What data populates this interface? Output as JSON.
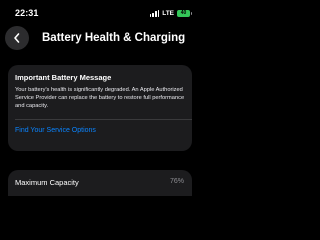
{
  "status_bar": {
    "time": "22:31",
    "network": "LTE",
    "battery_text": "40",
    "signal_icon": "cellular-signal-icon",
    "battery_icon": "battery-charging-icon",
    "battery_color": "#34c759"
  },
  "header": {
    "back_icon": "chevron-left-icon",
    "title": "Battery Health & Charging"
  },
  "message_card": {
    "title": "Important Battery Message",
    "body": "Your battery's health is significantly degraded. An Apple Authorized Service Provider can replace the battery to restore full performance and capacity.",
    "link_label": "Find Your Service Options",
    "link_color": "#0a84ff"
  },
  "capacity": {
    "label": "Maximum Capacity",
    "value": "76%"
  },
  "colors": {
    "background": "#000000",
    "card": "#1c1c1e",
    "secondary_text": "#8e8e93"
  }
}
